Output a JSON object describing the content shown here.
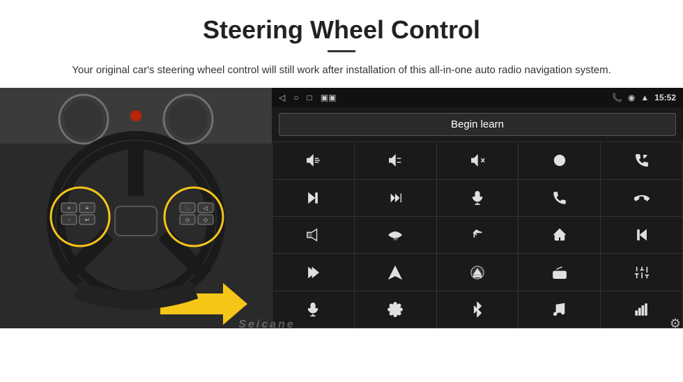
{
  "header": {
    "title": "Steering Wheel Control",
    "subtitle": "Your original car's steering wheel control will still work after installation of this all-in-one auto radio navigation system.",
    "divider": true
  },
  "status_bar": {
    "time": "15:52",
    "icons": [
      "back-arrow",
      "home-circle",
      "square",
      "signal",
      "phone",
      "location",
      "wifi"
    ]
  },
  "begin_learn": {
    "label": "Begin learn"
  },
  "grid": {
    "cells": [
      {
        "icon": "vol-up",
        "symbol": "🔊+"
      },
      {
        "icon": "vol-down",
        "symbol": "🔉-"
      },
      {
        "icon": "vol-mute",
        "symbol": "🔇"
      },
      {
        "icon": "power",
        "symbol": "⏻"
      },
      {
        "icon": "phone-prev",
        "symbol": "📞⏮"
      },
      {
        "icon": "next-track",
        "symbol": "⏭"
      },
      {
        "icon": "ff-next",
        "symbol": "⏩"
      },
      {
        "icon": "mic",
        "symbol": "🎤"
      },
      {
        "icon": "phone",
        "symbol": "📞"
      },
      {
        "icon": "hang-up",
        "symbol": "📵"
      },
      {
        "icon": "horn",
        "symbol": "📣"
      },
      {
        "icon": "camera-360",
        "symbol": "🎥"
      },
      {
        "icon": "return",
        "symbol": "↩"
      },
      {
        "icon": "home",
        "symbol": "⌂"
      },
      {
        "icon": "prev-track",
        "symbol": "⏮"
      },
      {
        "icon": "fast-forward",
        "symbol": "⏭"
      },
      {
        "icon": "navigate",
        "symbol": "▶"
      },
      {
        "icon": "eject",
        "symbol": "⏏"
      },
      {
        "icon": "radio",
        "symbol": "📻"
      },
      {
        "icon": "equalizer",
        "symbol": "🎛"
      },
      {
        "icon": "microphone2",
        "symbol": "🎙"
      },
      {
        "icon": "settings-knob",
        "symbol": "⚙"
      },
      {
        "icon": "bluetooth",
        "symbol": "⚡"
      },
      {
        "icon": "music",
        "symbol": "🎵"
      },
      {
        "icon": "volume-bars",
        "symbol": "📶"
      }
    ]
  },
  "watermark": "Seicane",
  "colors": {
    "bg_dark": "#1a1a1a",
    "grid_line": "#333",
    "text_light": "#e0e0e0",
    "yellow": "#f5c518"
  }
}
